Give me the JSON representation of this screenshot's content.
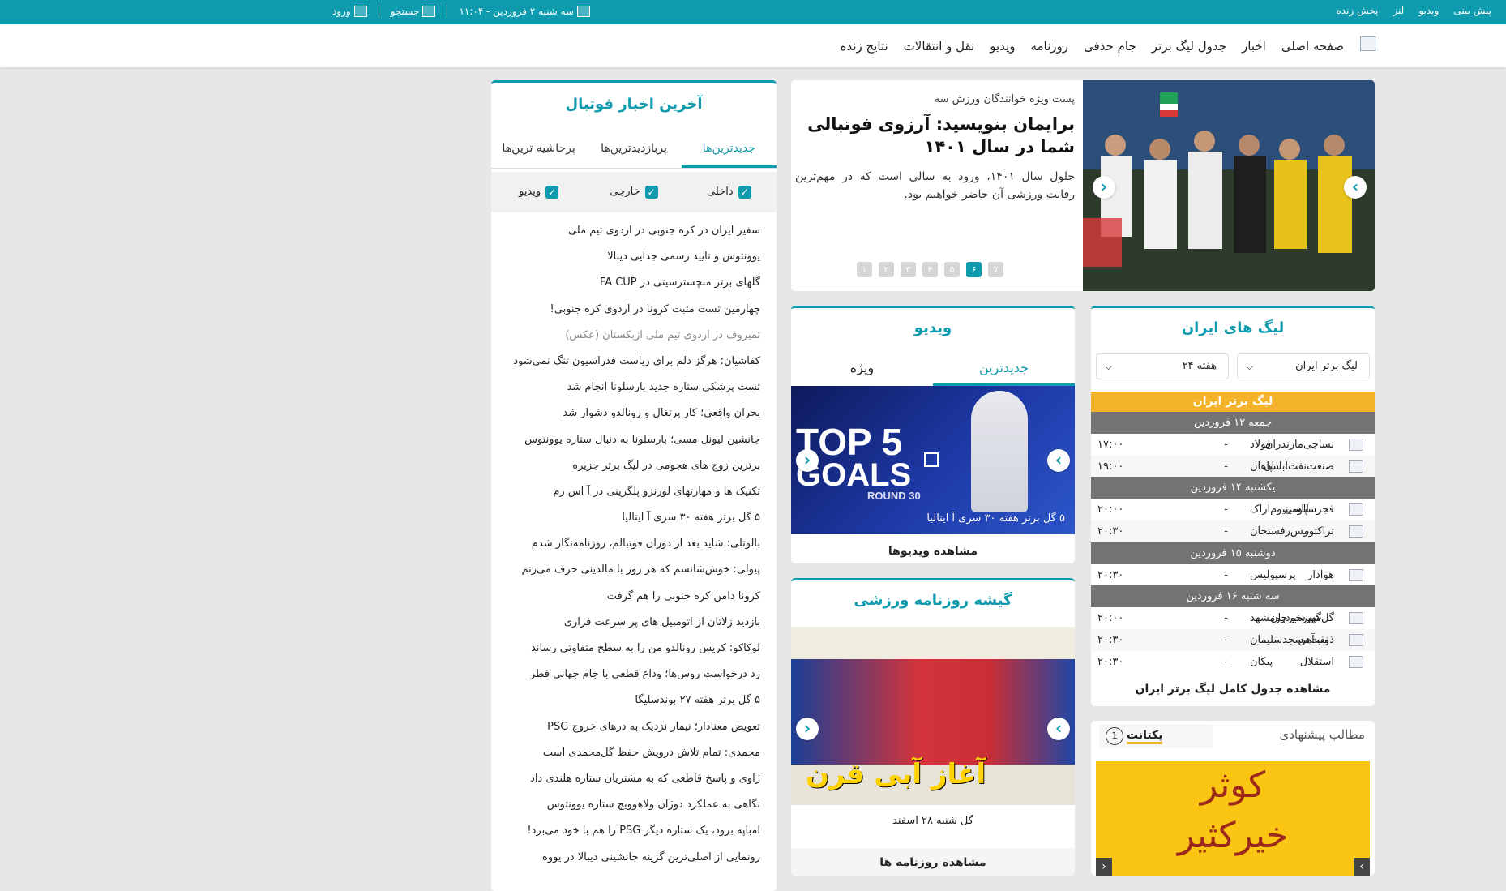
{
  "topbar": {
    "links": [
      "پیش بینی",
      "ویدیو",
      "لنز",
      "پخش زنده"
    ],
    "date": "سه شنبه ۲ فروردین - ۱۱:۰۴",
    "search_label": "جستجو",
    "login_label": "ورود",
    "background_color": "#0f9bae"
  },
  "nav": {
    "items": [
      "صفحه اصلی",
      "اخبار",
      "جدول لیگ برتر",
      "جام حذفی",
      "روزنامه",
      "ویدیو",
      "نقل و انتقالات",
      "نتایج زنده"
    ]
  },
  "hero": {
    "kicker": "پست ویژه خوانندگان ورزش سه",
    "title": "برایمان بنویسید: آرزوی فوتبالی شما در سال ۱۴۰۱",
    "summary": "حلول سال ۱۴۰۱، ورود به سالی است که در مهم‌ترین رقابت ورزشی آن حاضر خواهیم بود.",
    "pages": [
      "۱",
      "۲",
      "۳",
      "۴",
      "۵",
      "۶",
      "۷"
    ],
    "active_page": "۶"
  },
  "latest_news": {
    "title": "آخرین اخبار فوتبال",
    "tabs": [
      "جدیدترین‌ها",
      "پربازدیدترین‌ها",
      "پرحاشیه ترین‌ها"
    ],
    "filters": [
      "داخلی",
      "خارجی",
      "ویدیو"
    ],
    "items": [
      "سفیر ایران در کره جنوبی در اردوی تیم ملی",
      "یوونتوس و تایید رسمی جدایی دیبالا",
      "گلهای برتر منچسترسیتی در FA CUP",
      "چهارمین تست مثبت کرونا در اردوی کره جنوبی!",
      "تمیروف در اردوی تیم ملی ازبکستان (عکس)",
      "کفاشیان: هرگز دلم برای ریاست فدراسیون تنگ نمی‌شود",
      "تست پزشکی ستاره جدید بارسلونا انجام شد",
      "بحران واقعی؛ کار پرتغال و رونالدو دشوار شد",
      "جانشین لیونل مسی؛ بارسلونا به دنبال ستاره یوونتوس",
      "برترین زوج های هجومی در لیگ برتر جزیره",
      "تکنیک ها و مهارتهای لورنزو پلگرینی در آ اس رم",
      "۵ گل برتر هفته ۳۰ سری آ ایتالیا",
      "بالوتلی: شاید بعد از دوران فوتبالم، روزنامه‌نگار شدم",
      "پیولی: خوش‌شانسم که هر روز با مالدینی حرف می‌زنم",
      "کرونا دامن کره جنوبی را هم گرفت",
      "بازدید زلاتان از اتومبیل های پر سرعت فراری",
      "لوکاکو: کریس رونالدو من را به سطح متفاوتی رساند",
      "رد درخواست روس‌ها؛ وداع قطعی با جام جهانی قطر",
      "۵ گل برتر هفته ۲۷ بوندسلیگا",
      "تعویض معنادار؛ نیمار نزدیک به درهای خروج PSG",
      "محمدی: تمام تلاش درویش حفظ گل‌محمدی است",
      "ژاوی و پاسخ قاطعی که به مشتریان ستاره هلندی داد",
      "نگاهی به عملکرد دوژان ولاهوویچ ستاره یوونتوس",
      "امباپه برود، یک ستاره دیگر PSG را هم با خود می‌برد!",
      "رونمایی از اصلی‌ترین گزینه جانشینی دیبالا در یووه"
    ]
  },
  "league": {
    "title": "لیگ های ایران",
    "league_select": "لیگ برتر ایران",
    "week_select": "هفته ۲۴",
    "banner": "لیگ برتر ایران",
    "banner_color": "#f2b22a",
    "days": [
      {
        "label": "جمعه ۱۲ فروردین",
        "matches": [
          {
            "home": "نساجی‌مازندران",
            "away": "فولاد",
            "time": "۱۷:۰۰"
          },
          {
            "home": "صنعت‌نفت‌آبادان",
            "away": "سپاهان",
            "time": "۱۹:۰۰"
          }
        ]
      },
      {
        "label": "یکشنبه ۱۴ فروردین",
        "matches": [
          {
            "home": "فجرسپاسی",
            "away": "آلومینیوم‌اراک",
            "time": "۲۰:۰۰"
          },
          {
            "home": "تراکتور",
            "away": "مس‌رفسنجان",
            "time": "۲۰:۳۰"
          }
        ]
      },
      {
        "label": "دوشنبه ۱۵ فروردین",
        "matches": [
          {
            "home": "هوادار",
            "away": "پرسپولیس",
            "time": "۲۰:۳۰"
          }
        ]
      },
      {
        "label": "سه شنبه ۱۶ فروردین",
        "matches": [
          {
            "home": "گل‌گهرسیرجان",
            "away": "شهرخودرومشهد",
            "time": "۲۰:۰۰"
          },
          {
            "home": "ذوب‌آهن",
            "away": "نفت‌مسجدسلیمان",
            "time": "۲۰:۳۰"
          },
          {
            "home": "استقلال",
            "away": "پیکان",
            "time": "۲۰:۳۰"
          }
        ]
      }
    ],
    "full_table_link": "مشاهده جدول کامل لیگ برتر ایران"
  },
  "video": {
    "title": "ویدیو",
    "tabs": [
      "جدیدترین",
      "ویژه"
    ],
    "caption": "۵ گل برتر هفته ۳۰ سری آ ایتالیا",
    "thumb_text_top": "TOP 5",
    "thumb_text_goals": "GOALS",
    "thumb_text_round": "ROUND 30",
    "more_link": "مشاهده ویدیوها"
  },
  "newspaper": {
    "title": "گیشه روزنامه ورزشی",
    "headline": "آغاز آبی قرن",
    "caption": "گل شنبه ۲۸ اسفند",
    "more_link": "مشاهده روزنامه ها"
  },
  "suggested": {
    "title": "مطالب پیشنهادی",
    "brand": "یکتانت",
    "badge": "1",
    "ad_line1": "کوثر",
    "ad_line2": "خیرکثیر",
    "ad_color": "#fbc513"
  },
  "colors": {
    "accent": "#0f9bae",
    "day_bar": "#737373"
  }
}
